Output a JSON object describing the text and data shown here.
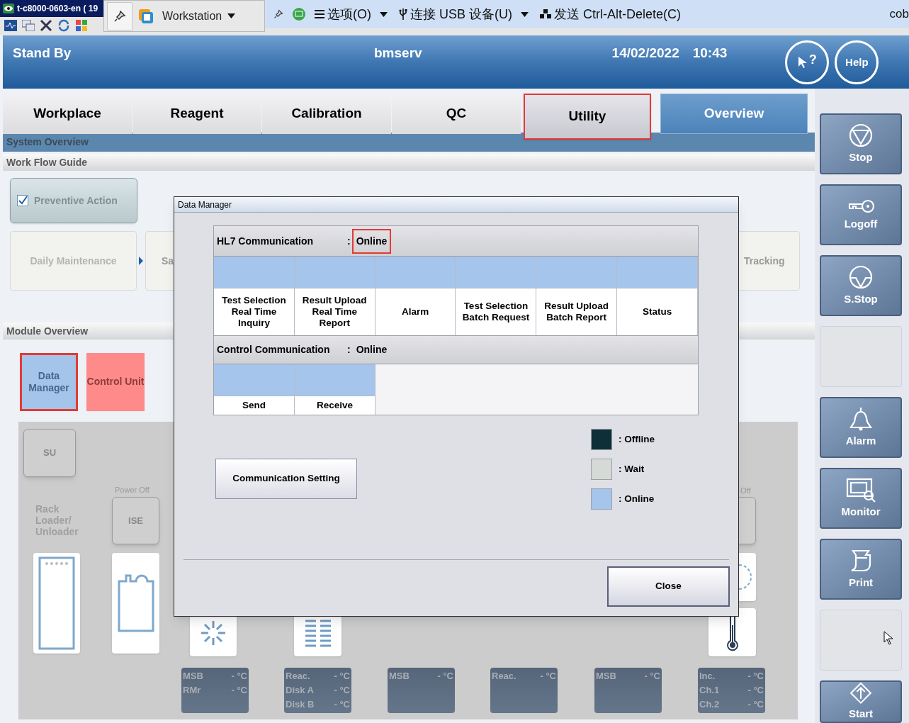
{
  "remote_bar": {
    "session": "t-c8000-0603-en ( 19",
    "workstation": "Workstation",
    "menus": [
      {
        "label": "选项(O)",
        "kind": "menu",
        "dropdown": true
      },
      {
        "label": "连接 USB 设备(U)",
        "kind": "usb",
        "dropdown": true
      },
      {
        "label": "发送 Ctrl-Alt-Delete(C)",
        "kind": "keys",
        "dropdown": false
      }
    ],
    "host": "cob"
  },
  "header": {
    "status": "Stand By",
    "user": "bmserv",
    "date": "14/02/2022",
    "time": "10:43",
    "pointer_help": "?",
    "help": "Help"
  },
  "tabs": [
    {
      "label": "Workplace",
      "selected": false,
      "highlighted": false
    },
    {
      "label": "Reagent",
      "selected": false,
      "highlighted": false
    },
    {
      "label": "Calibration",
      "selected": false,
      "highlighted": false
    },
    {
      "label": "QC",
      "selected": false,
      "highlighted": false
    },
    {
      "label": "Utility",
      "selected": false,
      "highlighted": true
    },
    {
      "label": "Overview",
      "selected": true,
      "highlighted": false
    }
  ],
  "system_overview": "System Overview",
  "work_flow": {
    "title": "Work Flow Guide",
    "preventive": {
      "label": "Preventive Action",
      "checked": true
    },
    "steps": [
      "Daily Maintenance",
      "Sa",
      "Tracking"
    ]
  },
  "module_overview": {
    "title": "Module Overview",
    "modules": [
      {
        "label": "Data Manager",
        "color": "#a4c4ea",
        "highlighted": true
      },
      {
        "label": "Control Unit",
        "color": "#ff8a8a",
        "highlighted": false
      }
    ]
  },
  "canvas": {
    "su": "SU",
    "rack_label": [
      "Rack",
      "Loader/",
      "Unloader"
    ],
    "power_off": "Power Off",
    "ise": "ISE",
    "power_off_right": "Off",
    "temps": [
      {
        "rows": [
          {
            "name": "MSB",
            "value": "- °C"
          },
          {
            "name": "RMr",
            "value": "- °C"
          }
        ]
      },
      {
        "rows": [
          {
            "name": "Reac.",
            "value": "- °C"
          },
          {
            "name": "Disk A",
            "value": "- °C"
          },
          {
            "name": "Disk B",
            "value": "- °C"
          }
        ]
      },
      {
        "rows": [
          {
            "name": "MSB",
            "value": "- °C"
          }
        ]
      },
      {
        "rows": [
          {
            "name": "Reac.",
            "value": "- °C"
          }
        ]
      },
      {
        "rows": [
          {
            "name": "MSB",
            "value": "- °C"
          }
        ]
      },
      {
        "rows": [
          {
            "name": "Inc.",
            "value": "- °C"
          },
          {
            "name": "Ch.1",
            "value": "- °C"
          },
          {
            "name": "Ch.2",
            "value": "- °C"
          }
        ]
      }
    ]
  },
  "side_buttons": [
    {
      "kind": "stop",
      "label": "Stop"
    },
    {
      "kind": "key",
      "label": "Logoff"
    },
    {
      "kind": "sstop",
      "label": "S.Stop"
    },
    {
      "kind": "empty"
    },
    {
      "kind": "alarm",
      "label": "Alarm"
    },
    {
      "kind": "monitor",
      "label": "Monitor"
    },
    {
      "kind": "print",
      "label": "Print"
    },
    {
      "kind": "empty"
    },
    {
      "kind": "start",
      "label": "Start"
    }
  ],
  "dialog": {
    "title": "Data Manager",
    "hl7": {
      "label": "HL7 Communication",
      "separator": ":",
      "status": "Online",
      "highlighted": true,
      "channels": [
        {
          "label": "Test Selection\nReal Time\nInquiry",
          "color": "#a6c5ec"
        },
        {
          "label": "Result Upload\nReal Time\nReport",
          "color": "#a6c5ec"
        },
        {
          "label": "Alarm",
          "color": "#a6c5ec"
        },
        {
          "label": "Test Selection\nBatch Request",
          "color": "#a6c5ec"
        },
        {
          "label": "Result Upload\nBatch Report",
          "color": "#a6c5ec"
        },
        {
          "label": "Status",
          "color": "#a6c5ec"
        }
      ]
    },
    "control": {
      "label": "Control Communication",
      "separator": ":",
      "status": "Online",
      "highlighted": false,
      "channels": [
        {
          "label": "Send",
          "color": "#a6c5ec"
        },
        {
          "label": "Receive",
          "color": "#a6c5ec"
        }
      ]
    },
    "legend": [
      {
        "color": "#0e2e38",
        "label": ": Offline"
      },
      {
        "color": "#d6dad6",
        "label": ": Wait"
      },
      {
        "color": "#a6c5ec",
        "label": ": Online"
      }
    ],
    "setting_button": "Communication Setting",
    "close_button": "Close"
  }
}
